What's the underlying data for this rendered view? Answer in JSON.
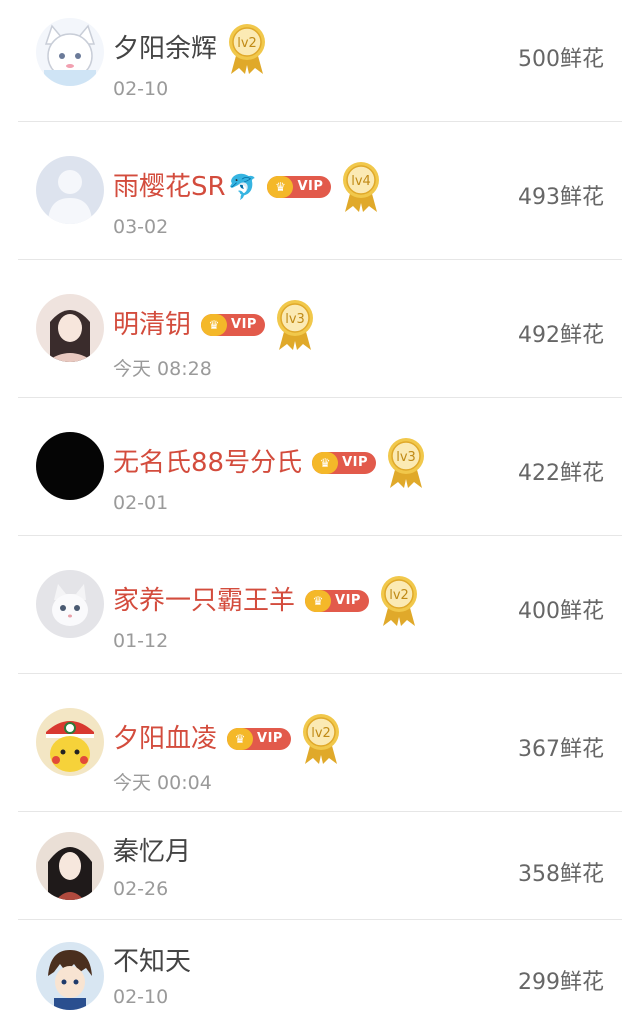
{
  "colors": {
    "vip_name": "#d34c3d",
    "plain_name": "#444444",
    "date": "#9a9a9a",
    "flowers": "#666666",
    "vip_badge": "#e25a4b",
    "crown": "#f4b829",
    "medal": "#e8b93a"
  },
  "rows": [
    {
      "name": "夕阳余辉",
      "vip": false,
      "level": "lv2",
      "date": "02-10",
      "flowers": "500鲜花",
      "avatar_icon": "white-cat-avatar"
    },
    {
      "name": "雨樱花SR",
      "emoji": "🐬",
      "vip": true,
      "vip_label": "VIP",
      "level": "lv4",
      "date": "03-02",
      "flowers": "493鲜花",
      "avatar_icon": "default-avatar"
    },
    {
      "name": "明清钥",
      "vip": true,
      "vip_label": "VIP",
      "level": "lv3",
      "date": "今天 08:28",
      "flowers": "492鲜花",
      "avatar_icon": "girl-avatar"
    },
    {
      "name": "无名氏88号分氏",
      "vip": true,
      "vip_label": "VIP",
      "level": "lv3",
      "date": "02-01",
      "flowers": "422鲜花",
      "avatar_icon": "black-avatar"
    },
    {
      "name": "家养一只霸王羊",
      "vip": true,
      "vip_label": "VIP",
      "level": "lv2",
      "date": "01-12",
      "flowers": "400鲜花",
      "avatar_icon": "kitten-avatar"
    },
    {
      "name": "夕阳血凌",
      "vip": true,
      "vip_label": "VIP",
      "level": "lv2",
      "date": "今天 00:04",
      "flowers": "367鲜花",
      "avatar_icon": "pikachu-avatar"
    },
    {
      "name": "秦忆月",
      "vip": false,
      "date": "02-26",
      "flowers": "358鲜花",
      "avatar_icon": "lady-avatar"
    },
    {
      "name": "不知天",
      "vip": false,
      "date": "02-10",
      "flowers": "299鲜花",
      "avatar_icon": "boy-avatar"
    }
  ]
}
